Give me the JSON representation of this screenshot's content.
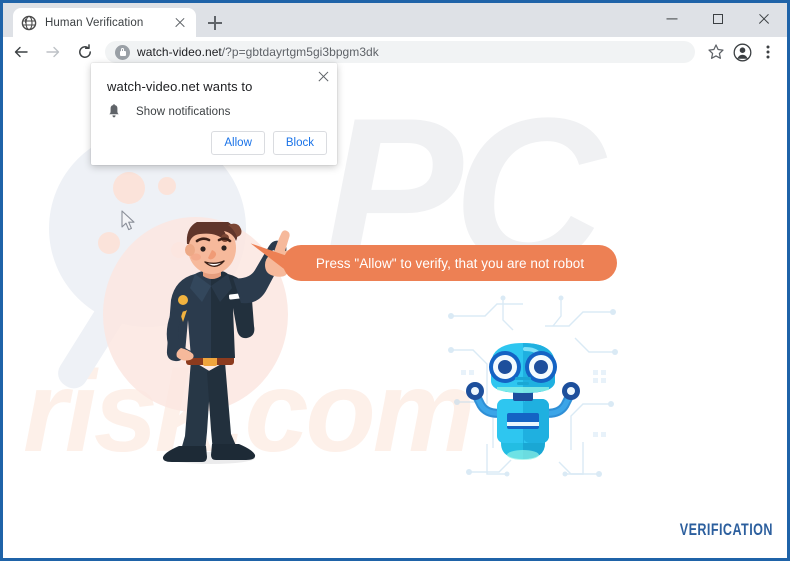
{
  "window": {
    "controls": [
      {
        "name": "minimize",
        "glyph": "minimize-icon"
      },
      {
        "name": "maximize",
        "glyph": "maximize-icon"
      },
      {
        "name": "close",
        "glyph": "close-icon"
      }
    ]
  },
  "browser": {
    "tab": {
      "title": "Human Verification",
      "favicon": "globe-icon",
      "close_label": "close-tab-icon"
    },
    "new_tab_label": "new-tab-icon",
    "toolbar": {
      "back": "back-arrow-icon",
      "forward": "forward-arrow-icon",
      "reload": "reload-icon",
      "lock": "lock-icon",
      "url_host": "watch-video.net",
      "url_path": "/?p=gbtdayrtgm5gi3bpgm3dk",
      "bookmark": "star-icon",
      "profile": "profile-avatar-icon",
      "menu": "three-dot-menu-icon"
    }
  },
  "notification": {
    "title": "watch-video.net wants to",
    "permission_label": "Show notifications",
    "permission_icon": "bell-icon",
    "close_label": "close-icon",
    "allow_label": "Allow",
    "block_label": "Block"
  },
  "page": {
    "speech_bubble": "Press \"Allow\" to verify, that you are not robot",
    "wordmark": "VERIFICATION",
    "watermark_top": "PC",
    "watermark_bottom": "risk.com",
    "character_man": "businessman-pointing-illustration",
    "character_robot": "blue-robot-illustration",
    "cursor": "mouse-cursor"
  },
  "colors": {
    "bubble": "#ed8054",
    "wordmark": "#2c5f9e",
    "chrome": "#dee1e6",
    "link": "#1a73e8",
    "frame": "#1f63a8"
  }
}
